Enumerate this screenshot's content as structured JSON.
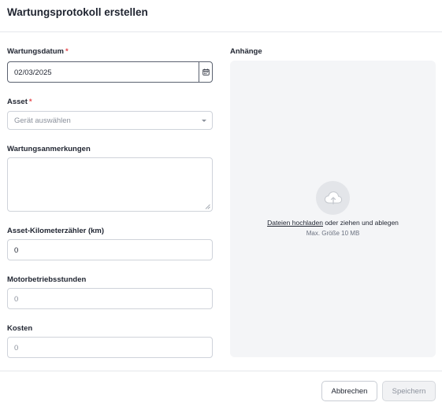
{
  "dialog": {
    "title": "Wartungsprotokoll erstellen"
  },
  "form": {
    "date": {
      "label": "Wartungsdatum",
      "required_mark": "*",
      "value": "02/03/2025"
    },
    "asset": {
      "label": "Asset",
      "required_mark": "*",
      "placeholder": "Gerät auswählen"
    },
    "notes": {
      "label": "Wartungsanmerkungen",
      "value": ""
    },
    "odometer": {
      "label": "Asset-Kilometerzähler (km)",
      "value": "0"
    },
    "engine_hours": {
      "label": "Motorbetriebsstunden",
      "placeholder": "0"
    },
    "cost": {
      "label": "Kosten",
      "placeholder": "0"
    }
  },
  "attachments": {
    "label": "Anhänge",
    "upload_link": "Dateien hochladen",
    "upload_suffix": " oder ziehen und ablegen",
    "max_size": "Max. Größe 10 MB",
    "icon": "cloud-upload-icon"
  },
  "footer": {
    "cancel_label": "Abbrechen",
    "save_label": "Speichern",
    "save_enabled": false
  },
  "colors": {
    "required": "#e5484d",
    "dropzone_bg": "#f4f5f7",
    "border": "#cfd3da"
  }
}
